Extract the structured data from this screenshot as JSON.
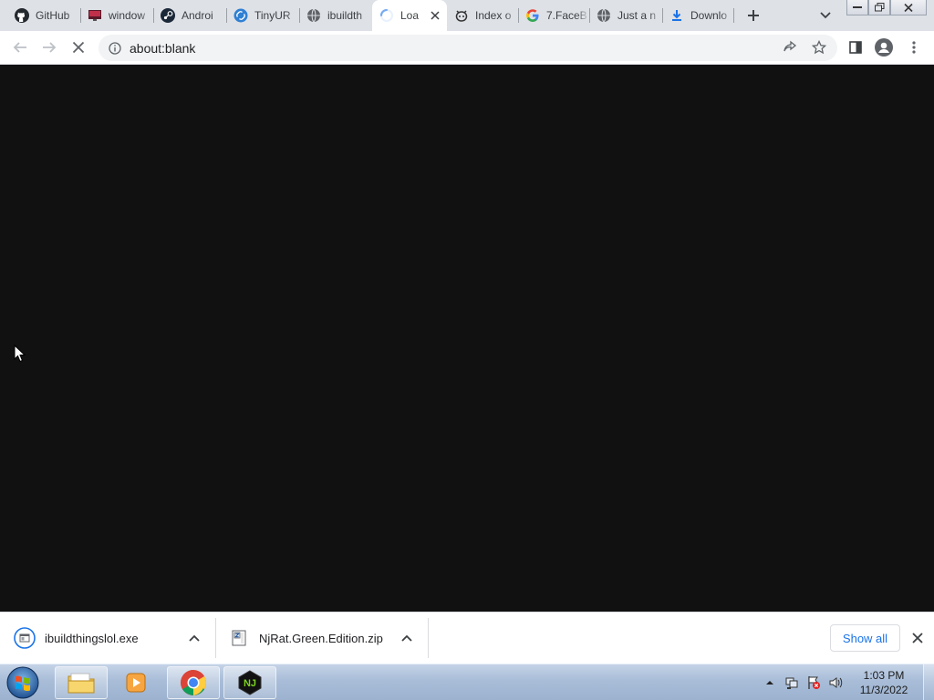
{
  "browser": {
    "tabs": [
      {
        "title": "GitHub",
        "icon": "github-icon"
      },
      {
        "title": "window",
        "icon": "windows-site-icon"
      },
      {
        "title": "Androi",
        "icon": "steam-icon"
      },
      {
        "title": "TinyUR",
        "icon": "tinyurl-icon"
      },
      {
        "title": "ibuildth",
        "icon": "globe-icon"
      },
      {
        "title": "Loa",
        "icon": "loading-spinner-icon",
        "active": true
      },
      {
        "title": "Index o",
        "icon": "github-octocat-icon"
      },
      {
        "title": "7.FaceB",
        "icon": "google-icon"
      },
      {
        "title": "Just a n",
        "icon": "globe-icon"
      },
      {
        "title": "Downlo",
        "icon": "download-icon"
      }
    ],
    "address": {
      "url": "about:blank"
    },
    "accent_color": "#1a73e8"
  },
  "downloads": {
    "items": [
      {
        "name": "ibuildthingslol.exe",
        "icon": "exe-file-icon"
      },
      {
        "name": "NjRat.Green.Edition.zip",
        "icon": "zip-file-icon"
      }
    ],
    "show_all_label": "Show all"
  },
  "taskbar": {
    "apps": [
      "file-explorer-icon",
      "media-player-icon",
      "chrome-icon",
      "njrat-icon"
    ],
    "clock": {
      "time": "1:03 PM",
      "date": "11/3/2022"
    }
  }
}
